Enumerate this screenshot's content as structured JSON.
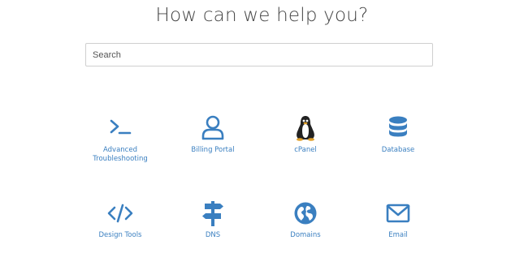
{
  "header": {
    "title": "How can we help you?"
  },
  "search": {
    "placeholder": "Search"
  },
  "categories": [
    {
      "label": "Advanced Troubleshooting",
      "icon": "terminal-icon"
    },
    {
      "label": "Billing Portal",
      "icon": "user-icon"
    },
    {
      "label": "cPanel",
      "icon": "linux-penguin-icon"
    },
    {
      "label": "Database",
      "icon": "database-icon"
    },
    {
      "label": "Design Tools",
      "icon": "code-icon"
    },
    {
      "label": "DNS",
      "icon": "signpost-icon"
    },
    {
      "label": "Domains",
      "icon": "globe-icon"
    },
    {
      "label": "Email",
      "icon": "envelope-icon"
    }
  ],
  "colors": {
    "accent": "#3a7fc0",
    "title": "#444444"
  }
}
